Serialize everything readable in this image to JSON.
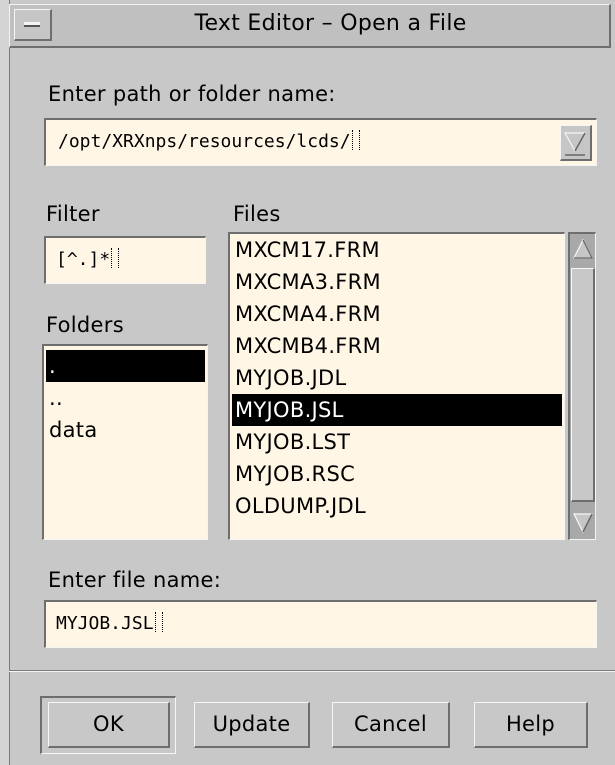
{
  "window": {
    "title": "Text Editor – Open a File",
    "menu_icon": "window-menu-icon"
  },
  "path": {
    "label": "Enter path or folder name:",
    "value": "/opt/XRXnps/resources/lcds/",
    "dropdown_icon": "chevron-down-icon"
  },
  "filter": {
    "label": "Filter",
    "value": "[^.]*"
  },
  "folders": {
    "label": "Folders",
    "items": [
      ".",
      "..",
      "data"
    ],
    "selected_index": 0
  },
  "files": {
    "label": "Files",
    "items": [
      "MXCM17.FRM",
      "MXCMA3.FRM",
      "MXCMA4.FRM",
      "MXCMB4.FRM",
      "MYJOB.JDL",
      "MYJOB.JSL",
      "MYJOB.LST",
      "MYJOB.RSC",
      "OLDUMP.JDL"
    ],
    "selected_index": 5
  },
  "filename": {
    "label": "Enter file name:",
    "value": "MYJOB.JSL"
  },
  "buttons": {
    "ok": "OK",
    "update": "Update",
    "cancel": "Cancel",
    "help": "Help"
  },
  "colors": {
    "background": "#c8c8c8",
    "field": "#fff6e6",
    "selection": "#000000"
  }
}
